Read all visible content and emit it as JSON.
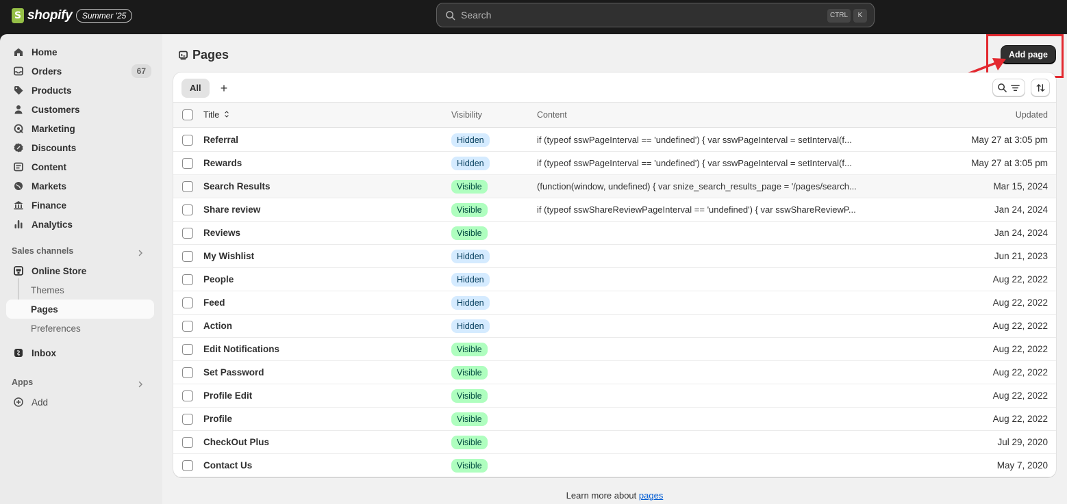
{
  "topbar": {
    "logo_text": "shopify",
    "edition_badge": "Summer '25",
    "search": {
      "placeholder": "Search",
      "shortcut_ctrl": "CTRL",
      "shortcut_key": "K"
    }
  },
  "sidebar": {
    "items": [
      {
        "label": "Home",
        "icon": "home-icon"
      },
      {
        "label": "Orders",
        "icon": "inbox-tray-icon",
        "count": "67"
      },
      {
        "label": "Products",
        "icon": "tag-icon"
      },
      {
        "label": "Customers",
        "icon": "person-icon"
      },
      {
        "label": "Marketing",
        "icon": "target-icon"
      },
      {
        "label": "Discounts",
        "icon": "discount-icon"
      },
      {
        "label": "Content",
        "icon": "content-icon"
      },
      {
        "label": "Markets",
        "icon": "globe-icon"
      },
      {
        "label": "Finance",
        "icon": "bank-icon"
      },
      {
        "label": "Analytics",
        "icon": "bar-chart-icon"
      }
    ],
    "sales_channels_label": "Sales channels",
    "online_store": {
      "label": "Online Store",
      "icon": "store-icon"
    },
    "online_store_sub": [
      "Themes",
      "Pages",
      "Preferences"
    ],
    "inbox": {
      "label": "Inbox",
      "icon": "shopify-inbox-icon"
    },
    "apps_label": "Apps",
    "add_label": "Add"
  },
  "page": {
    "title": "Pages",
    "add_button": "Add page",
    "tabs": [
      "All"
    ],
    "columns": {
      "title": "Title",
      "visibility": "Visibility",
      "content": "Content",
      "updated": "Updated"
    },
    "rows": [
      {
        "title": "Referral",
        "visibility": "Hidden",
        "content": "if (typeof sswPageInterval == 'undefined') { var sswPageInterval = setInterval(f...",
        "updated": "May 27 at 3:05 pm"
      },
      {
        "title": "Rewards",
        "visibility": "Hidden",
        "content": "if (typeof sswPageInterval == 'undefined') { var sswPageInterval = setInterval(f...",
        "updated": "May 27 at 3:05 pm"
      },
      {
        "title": "Search Results",
        "visibility": "Visible",
        "content": "(function(window, undefined) { var snize_search_results_page = '/pages/search...",
        "updated": "Mar 15, 2024"
      },
      {
        "title": "Share review",
        "visibility": "Visible",
        "content": "if (typeof sswShareReviewPageInterval == 'undefined') { var sswShareReviewP...",
        "updated": "Jan 24, 2024"
      },
      {
        "title": "Reviews",
        "visibility": "Visible",
        "content": "",
        "updated": "Jan 24, 2024"
      },
      {
        "title": "My Wishlist",
        "visibility": "Hidden",
        "content": "",
        "updated": "Jun 21, 2023"
      },
      {
        "title": "People",
        "visibility": "Hidden",
        "content": "",
        "updated": "Aug 22, 2022"
      },
      {
        "title": "Feed",
        "visibility": "Hidden",
        "content": "",
        "updated": "Aug 22, 2022"
      },
      {
        "title": "Action",
        "visibility": "Hidden",
        "content": "",
        "updated": "Aug 22, 2022"
      },
      {
        "title": "Edit Notifications",
        "visibility": "Visible",
        "content": "",
        "updated": "Aug 22, 2022"
      },
      {
        "title": "Set Password",
        "visibility": "Visible",
        "content": "",
        "updated": "Aug 22, 2022"
      },
      {
        "title": "Profile Edit",
        "visibility": "Visible",
        "content": "",
        "updated": "Aug 22, 2022"
      },
      {
        "title": "Profile",
        "visibility": "Visible",
        "content": "",
        "updated": "Aug 22, 2022"
      },
      {
        "title": "CheckOut Plus",
        "visibility": "Visible",
        "content": "",
        "updated": "Jul 29, 2020"
      },
      {
        "title": "Contact Us",
        "visibility": "Visible",
        "content": "",
        "updated": "May 7, 2020"
      }
    ],
    "footer_text": "Learn more about",
    "footer_link": "pages"
  },
  "colors": {
    "topbar": "#1a1a1a",
    "sidebar": "#ebebeb",
    "main_bg": "#f1f1f1",
    "primary_button": "#303030",
    "annotation_red": "#e3282f",
    "hidden_badge": "#d5ebff",
    "visible_badge": "#affebf",
    "link": "#005bd3"
  }
}
